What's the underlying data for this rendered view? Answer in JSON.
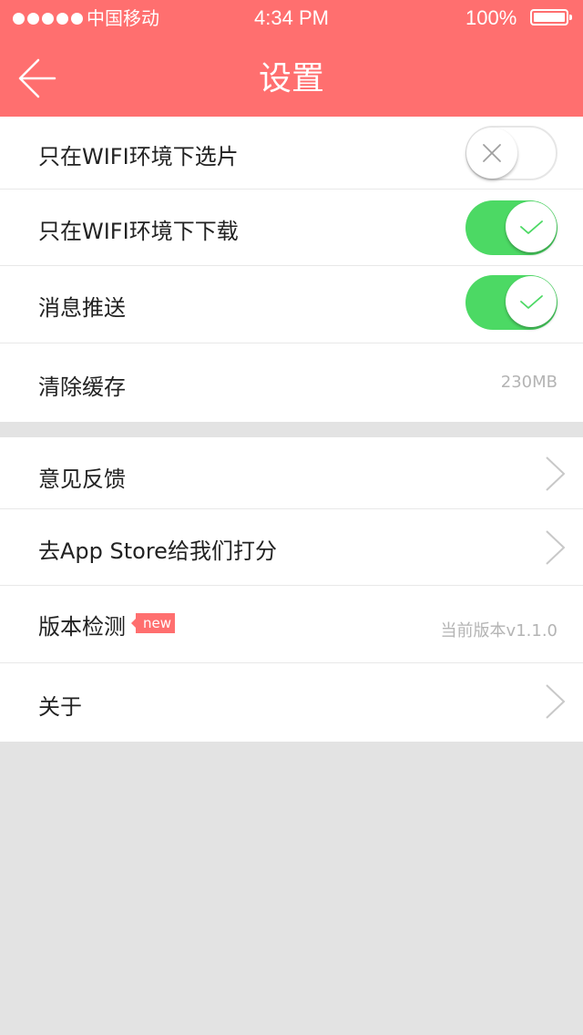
{
  "status_bar": {
    "carrier": "中国移动",
    "time": "4:34 PM",
    "battery": "100%"
  },
  "nav": {
    "title": "设置",
    "back_icon": "arrow-left-icon"
  },
  "section1": {
    "items": [
      {
        "label": "只在WIFI环境下选片",
        "control": "toggle",
        "on": false
      },
      {
        "label": "只在WIFI环境下下载",
        "control": "toggle",
        "on": true
      },
      {
        "label": "消息推送",
        "control": "toggle",
        "on": true
      },
      {
        "label": "清除缓存",
        "value": "230MB"
      }
    ]
  },
  "section2": {
    "items": [
      {
        "label": "意见反馈",
        "icon": "chevron-right-icon"
      },
      {
        "label": "去App Store给我们打分",
        "icon": "chevron-right-icon"
      },
      {
        "label": "版本检测",
        "badge": "new",
        "value": "当前版本v1.1.0"
      },
      {
        "label": "关于",
        "icon": "chevron-right-icon"
      }
    ]
  },
  "colors": {
    "accent": "#ff6f6f",
    "toggle_on": "#4cd964",
    "background": "#e3e3e3"
  }
}
